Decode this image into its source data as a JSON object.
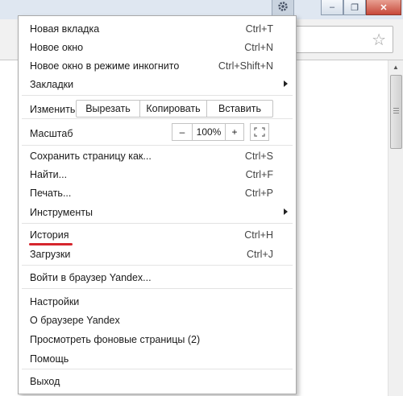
{
  "window_controls": {
    "minimize": "–",
    "restore": "❐",
    "close": "✕"
  },
  "menu": {
    "new_tab": {
      "label": "Новая вкладка",
      "shortcut": "Ctrl+T"
    },
    "new_window": {
      "label": "Новое окно",
      "shortcut": "Ctrl+N"
    },
    "incognito": {
      "label": "Новое окно в режиме инкогнито",
      "shortcut": "Ctrl+Shift+N"
    },
    "bookmarks": {
      "label": "Закладки"
    },
    "edit": {
      "label": "Изменить",
      "cut": "Вырезать",
      "copy": "Копировать",
      "paste": "Вставить"
    },
    "zoom": {
      "label": "Масштаб",
      "minus": "–",
      "value": "100%",
      "plus": "+"
    },
    "save_page": {
      "label": "Сохранить страницу как...",
      "shortcut": "Ctrl+S"
    },
    "find": {
      "label": "Найти...",
      "shortcut": "Ctrl+F"
    },
    "print": {
      "label": "Печать...",
      "shortcut": "Ctrl+P"
    },
    "tools": {
      "label": "Инструменты"
    },
    "history": {
      "label": "История",
      "shortcut": "Ctrl+H"
    },
    "downloads": {
      "label": "Загрузки",
      "shortcut": "Ctrl+J"
    },
    "sign_in": {
      "label": "Войти в браузер Yandex..."
    },
    "settings": {
      "label": "Настройки"
    },
    "about": {
      "label": "О браузере Yandex"
    },
    "background_pages": {
      "label": "Просмотреть фоновые страницы (2)"
    },
    "help": {
      "label": "Помощь"
    },
    "exit": {
      "label": "Выход"
    }
  },
  "highlight_color": "#d6262d"
}
